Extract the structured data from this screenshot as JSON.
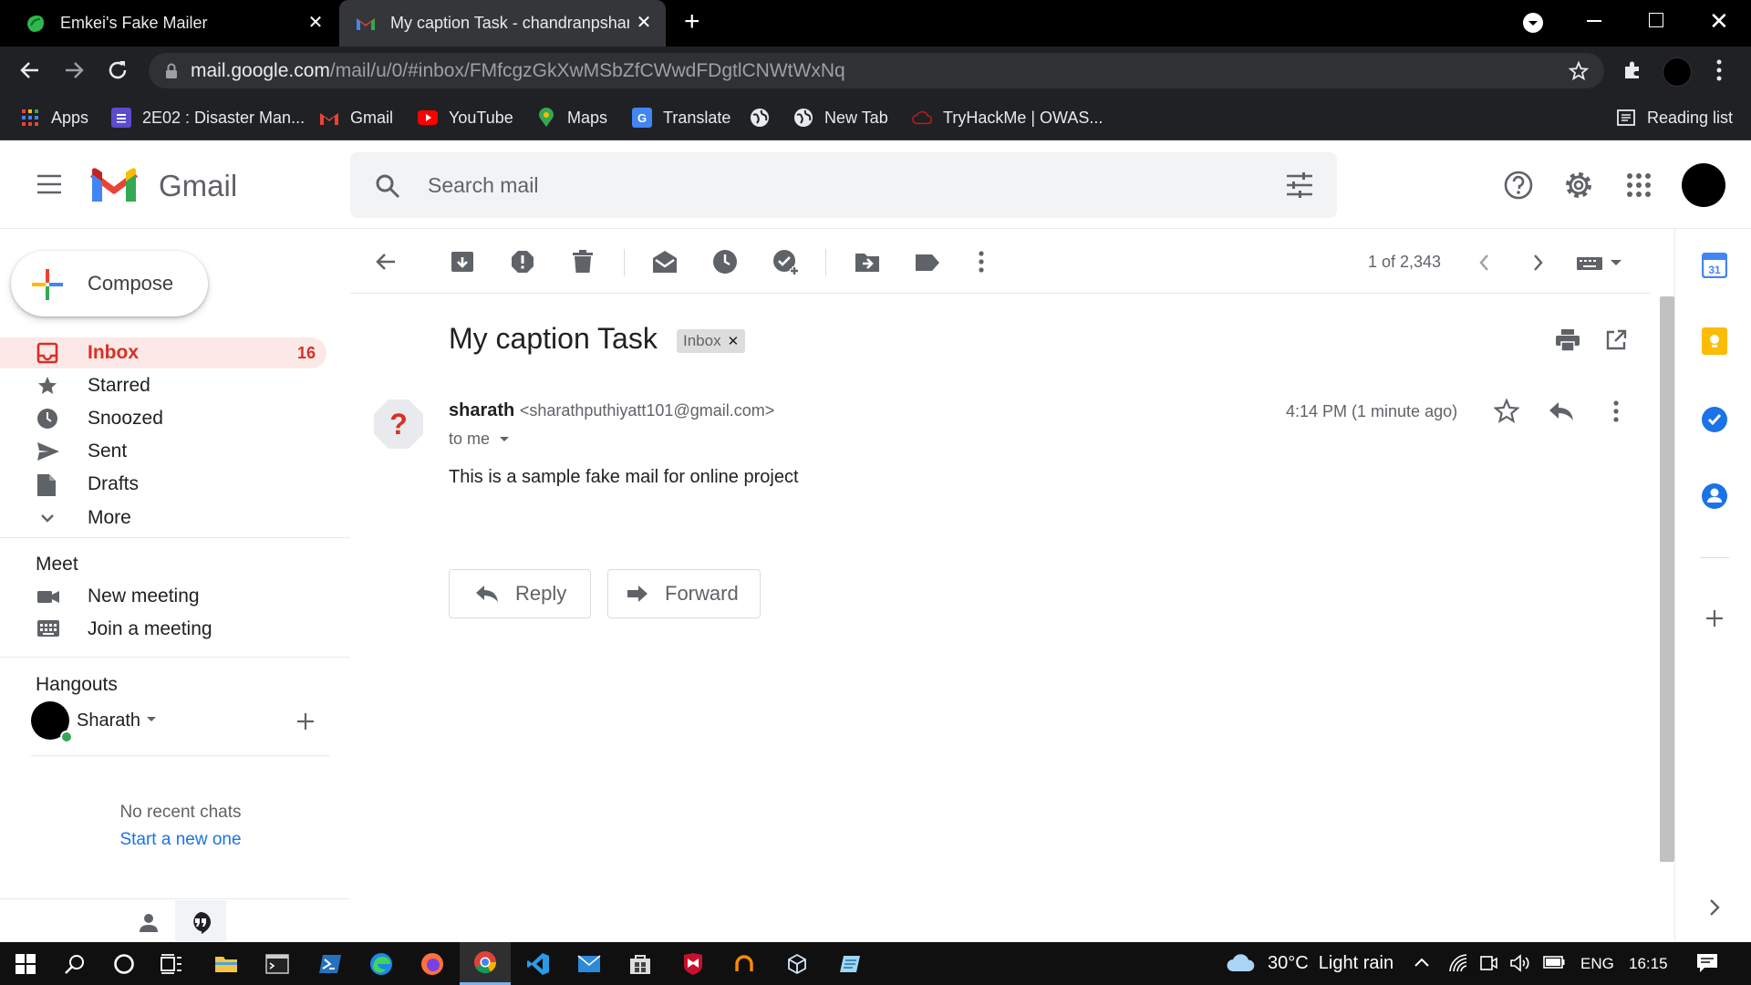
{
  "browser": {
    "tabs": [
      {
        "title": "Emkei's Fake Mailer"
      },
      {
        "title": "My caption Task - chandranpshar"
      }
    ],
    "url_host": "mail.google.com",
    "url_path": "/mail/u/0/#inbox/FMfcgzGkXwMSbZfCWwdFDgtlCNWtWxNq",
    "bookmarks": [
      "Apps",
      "2E02 : Disaster Man...",
      "Gmail",
      "YouTube",
      "Maps",
      "Translate",
      "New Tab",
      "TryHackMe | OWAS..."
    ],
    "reading_list": "Reading list"
  },
  "gmail": {
    "logo_text": "Gmail",
    "search_placeholder": "Search mail",
    "compose_label": "Compose",
    "nav": [
      {
        "label": "Inbox",
        "count": "16"
      },
      {
        "label": "Starred"
      },
      {
        "label": "Snoozed"
      },
      {
        "label": "Sent"
      },
      {
        "label": "Drafts"
      },
      {
        "label": "More"
      }
    ],
    "meet": {
      "title": "Meet",
      "items": [
        "New meeting",
        "Join a meeting"
      ]
    },
    "hangouts": {
      "title": "Hangouts",
      "user": "Sharath",
      "no_chats": "No recent chats",
      "start_link": "Start a new one"
    },
    "pagination": "1 of 2,343",
    "message": {
      "subject": "My caption Task",
      "label_chip": "Inbox",
      "sender_name": "sharath",
      "sender_email": "<sharathputhiyatt101@gmail.com>",
      "to_line": "to me",
      "time": "4:14 PM (1 minute ago)",
      "body": "This is a sample fake mail for online project",
      "reply_label": "Reply",
      "forward_label": "Forward"
    }
  },
  "taskbar": {
    "weather": "30°C  Light rain",
    "lang": "ENG",
    "clock": "16:15"
  },
  "colors": {
    "accent_red": "#d93025",
    "inbox_highlight": "#fce8e6",
    "link_blue": "#1a73e8"
  }
}
